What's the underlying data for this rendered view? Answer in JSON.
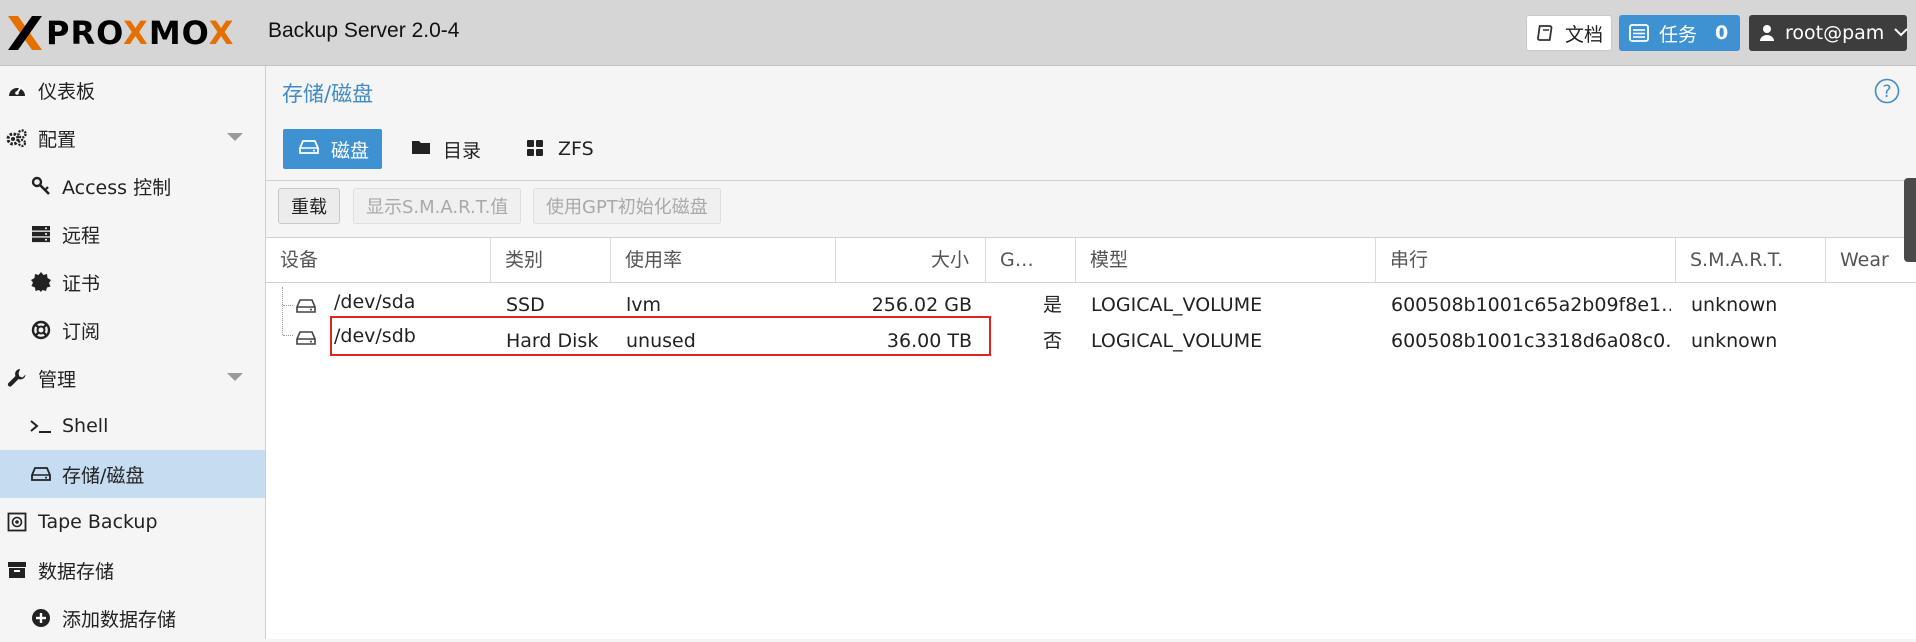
{
  "topbar": {
    "logo_prefix": "PRO",
    "logo_x": "X",
    "logo_middle": "MO",
    "logo_suffix": "X",
    "product": "Backup Server 2.0-4",
    "docs_label": "文档",
    "tasks_label": "任务",
    "tasks_count": "0",
    "user_label": "root@pam"
  },
  "sidebar": {
    "items": [
      {
        "label": "仪表板",
        "icon": "dashboard-icon"
      },
      {
        "label": "配置",
        "icon": "gears-icon"
      },
      {
        "label": "Access 控制",
        "icon": "key-icon"
      },
      {
        "label": "远程",
        "icon": "server-icon"
      },
      {
        "label": "证书",
        "icon": "certificate-icon"
      },
      {
        "label": "订阅",
        "icon": "lifebuoy-icon"
      },
      {
        "label": "管理",
        "icon": "wrench-icon"
      },
      {
        "label": "Shell",
        "icon": "terminal-icon"
      },
      {
        "label": "存储/磁盘",
        "icon": "hdd-icon"
      },
      {
        "label": "Tape Backup",
        "icon": "tape-icon"
      },
      {
        "label": "数据存储",
        "icon": "archive-icon"
      },
      {
        "label": "添加数据存储",
        "icon": "plus-circle-icon"
      }
    ]
  },
  "panel": {
    "title": "存储/磁盘",
    "tabs": [
      {
        "label": "磁盘",
        "icon": "hdd-icon"
      },
      {
        "label": "目录",
        "icon": "folder-icon"
      },
      {
        "label": "ZFS",
        "icon": "th-large-icon"
      }
    ],
    "toolbar": {
      "reload": "重载",
      "show_smart": "显示S.M.A.R.T.值",
      "init_gpt": "使用GPT初始化磁盘"
    }
  },
  "grid": {
    "columns": [
      "设备",
      "类别",
      "使用率",
      "大小",
      "G…",
      "模型",
      "串行",
      "S.M.A.R.T.",
      "Wear"
    ],
    "rows": [
      {
        "device": "/dev/sda",
        "type": "SSD",
        "usage": "lvm",
        "size": "256.02 GB",
        "gpt": "是",
        "model": "LOGICAL_VOLUME",
        "serial": "600508b1001c65a2b09f8e1…",
        "smart": "unknown"
      },
      {
        "device": "/dev/sdb",
        "type": "Hard Disk",
        "usage": "unused",
        "size": "36.00 TB",
        "gpt": "否",
        "model": "LOGICAL_VOLUME",
        "serial": "600508b1001c3318d6a08c0…",
        "smart": "unknown"
      }
    ]
  },
  "colors": {
    "accent": "#3f92d2",
    "brand_orange": "#e57000",
    "selected_row": "#c5dcf1",
    "highlight_box": "#e02424"
  }
}
